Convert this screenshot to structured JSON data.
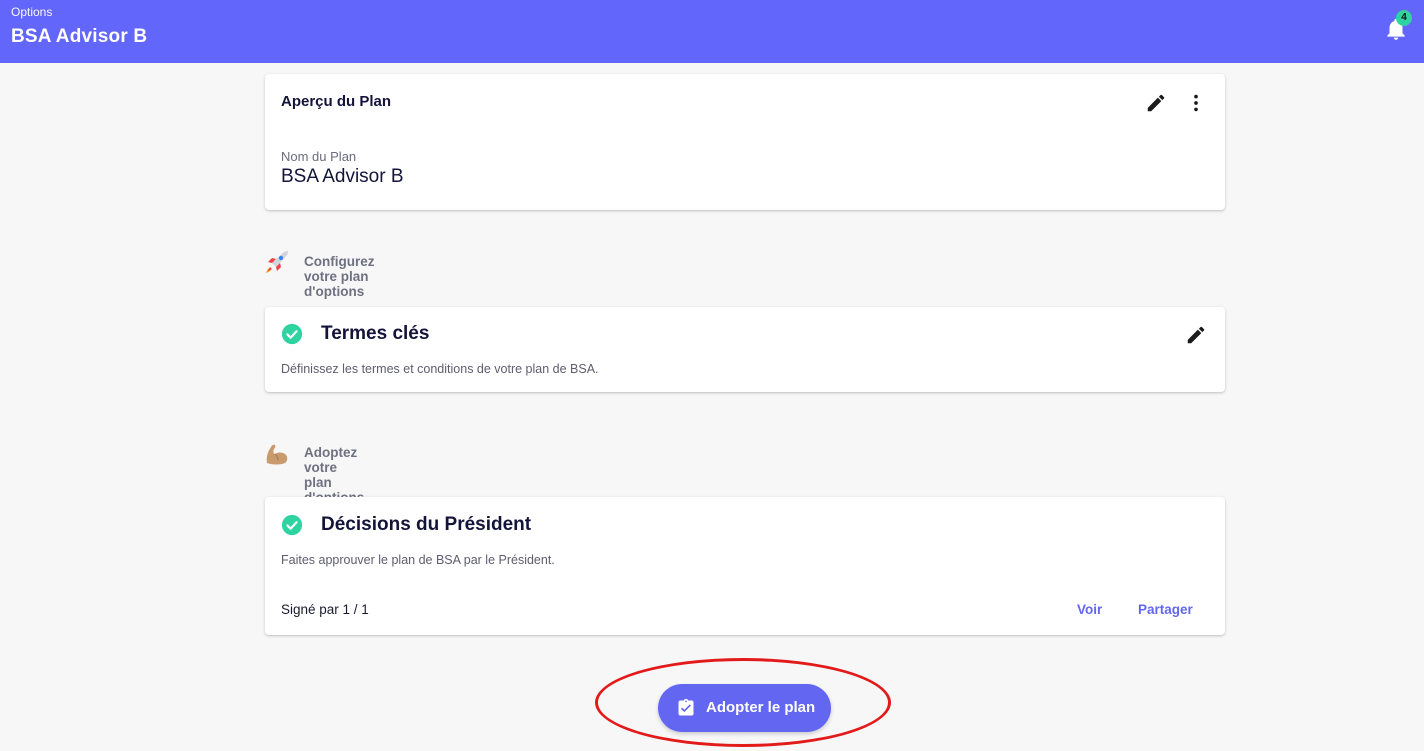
{
  "appbar": {
    "subtitle": "Options",
    "title": "BSA Advisor B",
    "notification_count": "4",
    "accent": "#6366fb",
    "badge_color": "#2ed3a0"
  },
  "overview": {
    "header": "Aperçu du Plan",
    "plan_name_label": "Nom du Plan",
    "plan_name_value": "BSA Advisor B",
    "icons": [
      "edit-icon",
      "more-vert-icon"
    ]
  },
  "section_configure": {
    "emoji": "rocket-emoji",
    "label": "Configurez votre plan d'options"
  },
  "key_terms": {
    "title": "Termes clés",
    "description": "Définissez les termes et conditions de votre plan de BSA.",
    "status": "check-circle-icon",
    "action_icon": "edit-icon"
  },
  "section_adopt": {
    "emoji": "flexed-biceps-emoji",
    "label": "Adoptez votre plan d'options"
  },
  "president": {
    "title": "Décisions du Président",
    "description": "Faites approuver le plan de BSA par le Président.",
    "signed": "Signé par 1 / 1",
    "view_label": "Voir",
    "share_label": "Partager",
    "status": "check-circle-icon"
  },
  "adopt_button": {
    "label": "Adopter le plan",
    "icon": "clipboard-check-icon",
    "color": "#6366f1"
  },
  "highlight": {
    "color": "#e21a1a",
    "shape": "ellipse"
  }
}
